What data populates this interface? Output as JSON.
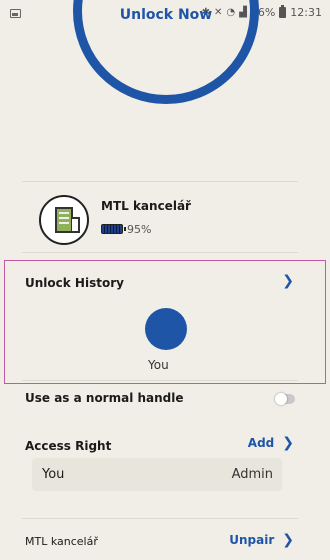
{
  "status_bar": {
    "battery": "46%",
    "time": "12:31"
  },
  "unlock_button": {
    "label": "Unlock Now"
  },
  "device": {
    "name": "MTL kancelář",
    "battery": "95%"
  },
  "unlock_history": {
    "title": "Unlock History",
    "entries": [
      "You"
    ]
  },
  "normal_handle": {
    "label": "Use as a normal handle",
    "enabled": false
  },
  "access_right": {
    "title": "Access Right",
    "add_label": "Add",
    "users": [
      {
        "name": "You",
        "role": "Admin"
      }
    ]
  },
  "unpair": {
    "device_name": "MTL kancelář",
    "label": "Unpair"
  },
  "colors": {
    "accent": "#1f55a6",
    "background": "#f0eee6"
  },
  "icons": [
    "image-icon",
    "bluetooth-icon",
    "mute-icon",
    "wifi-icon",
    "signal-icon",
    "battery-icon",
    "lock-icon",
    "building-icon",
    "chevron-right-icon"
  ]
}
